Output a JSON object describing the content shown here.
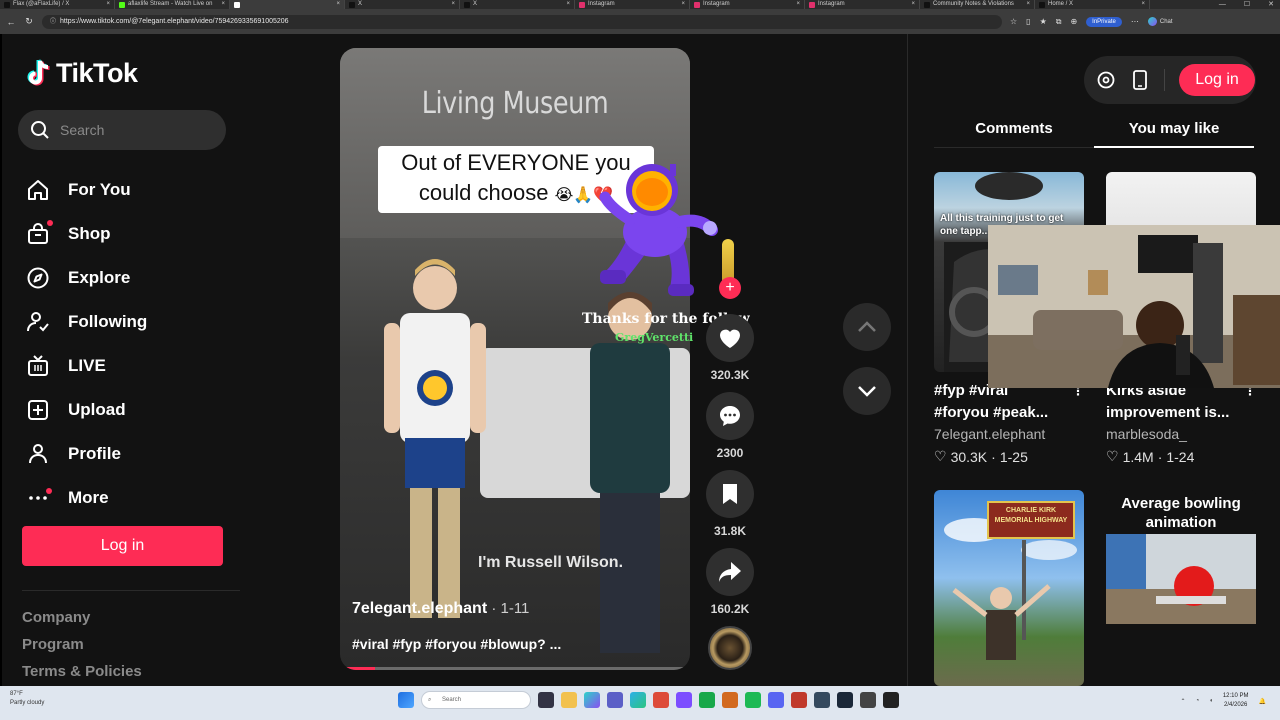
{
  "browser": {
    "tabs": [
      {
        "label": "Flax (@aFlaxLife) / X",
        "color": "#111111",
        "active": false
      },
      {
        "label": "aflaxlife Stream - Watch Live on",
        "color": "#53fc18",
        "active": false
      },
      {
        "label": "",
        "color": "#ffffff",
        "active": true
      },
      {
        "label": "X",
        "color": "#111111",
        "active": false
      },
      {
        "label": "X",
        "color": "#111111",
        "active": false
      },
      {
        "label": "Instagram",
        "color": "#e1306c",
        "active": false
      },
      {
        "label": "Instagram",
        "color": "#e1306c",
        "active": false
      },
      {
        "label": "Instagram",
        "color": "#e1306c",
        "active": false
      },
      {
        "label": "Community Notes & Violations",
        "color": "#111111",
        "active": false
      },
      {
        "label": "Home / X",
        "color": "#111111",
        "active": false
      }
    ],
    "url": "https://www.tiktok.com/@7elegant.elephant/video/7594269335691005206",
    "inprivate": "InPrivate",
    "chat": "Chat"
  },
  "sidebar": {
    "logo": "TikTok",
    "search_placeholder": "Search",
    "nav": [
      {
        "label": "For You",
        "icon": "home-icon"
      },
      {
        "label": "Shop",
        "icon": "shop-icon"
      },
      {
        "label": "Explore",
        "icon": "compass-icon"
      },
      {
        "label": "Following",
        "icon": "following-icon"
      },
      {
        "label": "LIVE",
        "icon": "live-icon"
      },
      {
        "label": "Upload",
        "icon": "upload-icon"
      },
      {
        "label": "Profile",
        "icon": "profile-icon"
      },
      {
        "label": "More",
        "icon": "more-icon"
      }
    ],
    "login": "Log in",
    "footer": [
      "Company",
      "Program",
      "Terms & Policies"
    ]
  },
  "video": {
    "overlay_title": "Living Museum",
    "caption_line1": "Out of EVERYONE you",
    "caption_line2": "could choose",
    "caption_emoji": "😭🙏💔",
    "subtitle": "I'm Russell Wilson.",
    "author": "7elegant.elephant",
    "date": " · 1-11",
    "description": "#viral #fyp #foryou #blowup? ...",
    "progress": 0.1,
    "gift_text": "Thanks for the follow",
    "gift_name": "GregVercetti"
  },
  "actions": {
    "likes": "320.3K",
    "comments": "2300",
    "saves": "31.8K",
    "shares": "160.2K",
    "follow_plus": "+"
  },
  "right_panel": {
    "login": "Log in",
    "tabs": [
      "Comments",
      "You may like"
    ],
    "active_tab": 1,
    "cards": [
      {
        "title_line1": "#fyp #viral",
        "title_line2": "#foryou #peak...",
        "author": "7elegant.elephant",
        "likes": "30.3K",
        "date": "1-25",
        "thumb_text": "All this training just to get one tapp... in Flip..."
      },
      {
        "title_line1": "Kirks aside",
        "title_line2": "improvement is...",
        "author": "marblesoda_",
        "likes": "1.4M",
        "date": "1-24",
        "thumb_text": ""
      },
      {
        "title_line1": "",
        "title_line2": "",
        "author": "",
        "likes": "",
        "date": "",
        "thumb_text": "CHARLIE KIRK MEMORIAL HIGHWAY"
      },
      {
        "title_line1": "",
        "title_line2": "",
        "author": "",
        "likes": "",
        "date": "",
        "thumb_text": "Average bowling animation"
      }
    ]
  },
  "taskbar": {
    "weather_temp": "87°F",
    "weather_desc": "Partly cloudy",
    "search": "Search",
    "time": "12:10 PM",
    "date": "2/4/2026"
  },
  "colors": {
    "accent": "#fe2c55",
    "bg": "#121212",
    "panel": "#2f2f2f"
  }
}
